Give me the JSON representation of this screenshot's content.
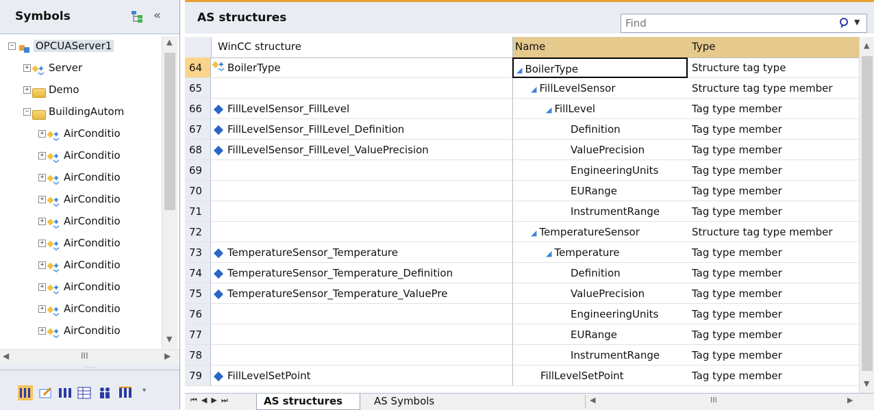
{
  "left_panel": {
    "title": "Symbols",
    "tree": [
      {
        "label": "OPCUAServer1",
        "level": 0,
        "expander": "−",
        "icon": "server-root-icon"
      },
      {
        "label": "Server",
        "level": 1,
        "expander": "+",
        "icon": "structure-icon"
      },
      {
        "label": "Demo",
        "level": 1,
        "expander": "+",
        "icon": "folder-icon"
      },
      {
        "label": "BuildingAutom",
        "level": 1,
        "expander": "−",
        "icon": "folder-icon"
      },
      {
        "label": "AirConditio",
        "level": 2,
        "expander": "+",
        "icon": "structure-icon"
      },
      {
        "label": "AirConditio",
        "level": 2,
        "expander": "+",
        "icon": "structure-icon"
      },
      {
        "label": "AirConditio",
        "level": 2,
        "expander": "+",
        "icon": "structure-icon"
      },
      {
        "label": "AirConditio",
        "level": 2,
        "expander": "+",
        "icon": "structure-icon"
      },
      {
        "label": "AirConditio",
        "level": 2,
        "expander": "+",
        "icon": "structure-icon"
      },
      {
        "label": "AirConditio",
        "level": 2,
        "expander": "+",
        "icon": "structure-icon"
      },
      {
        "label": "AirConditio",
        "level": 2,
        "expander": "+",
        "icon": "structure-icon"
      },
      {
        "label": "AirConditio",
        "level": 2,
        "expander": "+",
        "icon": "structure-icon"
      },
      {
        "label": "AirConditio",
        "level": 2,
        "expander": "+",
        "icon": "structure-icon"
      },
      {
        "label": "AirConditio",
        "level": 2,
        "expander": "+",
        "icon": "structure-icon"
      }
    ],
    "scroll_grip": "III",
    "splitter_grip": "......"
  },
  "right_panel": {
    "title": "AS structures",
    "find_placeholder": "Find",
    "columns": {
      "wincc": "WinCC structure",
      "name": "Name",
      "type": "Type"
    },
    "rows": [
      {
        "num": "64",
        "wincc": "BoilerType",
        "wincc_icon": "structure",
        "name": "BoilerType",
        "name_indent": 0,
        "name_tri": true,
        "type": "Structure tag type",
        "selected": true
      },
      {
        "num": "65",
        "wincc": "",
        "wincc_icon": "",
        "name": "FillLevelSensor",
        "name_indent": 1,
        "name_tri": true,
        "type": "Structure tag type member"
      },
      {
        "num": "66",
        "wincc": "FillLevelSensor_FillLevel",
        "wincc_icon": "tag",
        "name": "FillLevel",
        "name_indent": 2,
        "name_tri": true,
        "type": "Tag type member"
      },
      {
        "num": "67",
        "wincc": "FillLevelSensor_FillLevel_Definition",
        "wincc_icon": "tag",
        "name": "Definition",
        "name_indent": 3,
        "name_tri": false,
        "type": "Tag type member"
      },
      {
        "num": "68",
        "wincc": "FillLevelSensor_FillLevel_ValuePrecision",
        "wincc_icon": "tag",
        "name": "ValuePrecision",
        "name_indent": 3,
        "name_tri": false,
        "type": "Tag type member"
      },
      {
        "num": "69",
        "wincc": "",
        "wincc_icon": "",
        "name": "EngineeringUnits",
        "name_indent": 3,
        "name_tri": false,
        "type": "Tag type member"
      },
      {
        "num": "70",
        "wincc": "",
        "wincc_icon": "",
        "name": "EURange",
        "name_indent": 3,
        "name_tri": false,
        "type": "Tag type member"
      },
      {
        "num": "71",
        "wincc": "",
        "wincc_icon": "",
        "name": "InstrumentRange",
        "name_indent": 3,
        "name_tri": false,
        "type": "Tag type member"
      },
      {
        "num": "72",
        "wincc": "",
        "wincc_icon": "",
        "name": "TemperatureSensor",
        "name_indent": 1,
        "name_tri": true,
        "type": "Structure tag type member"
      },
      {
        "num": "73",
        "wincc": "TemperatureSensor_Temperature",
        "wincc_icon": "tag",
        "name": "Temperature",
        "name_indent": 2,
        "name_tri": true,
        "type": "Tag type member"
      },
      {
        "num": "74",
        "wincc": "TemperatureSensor_Temperature_Definition",
        "wincc_icon": "tag",
        "name": "Definition",
        "name_indent": 3,
        "name_tri": false,
        "type": "Tag type member"
      },
      {
        "num": "75",
        "wincc": "TemperatureSensor_Temperature_ValuePre",
        "wincc_icon": "tag",
        "name": "ValuePrecision",
        "name_indent": 3,
        "name_tri": false,
        "type": "Tag type member"
      },
      {
        "num": "76",
        "wincc": "",
        "wincc_icon": "",
        "name": "EngineeringUnits",
        "name_indent": 3,
        "name_tri": false,
        "type": "Tag type member"
      },
      {
        "num": "77",
        "wincc": "",
        "wincc_icon": "",
        "name": "EURange",
        "name_indent": 3,
        "name_tri": false,
        "type": "Tag type member"
      },
      {
        "num": "78",
        "wincc": "",
        "wincc_icon": "",
        "name": "InstrumentRange",
        "name_indent": 3,
        "name_tri": false,
        "type": "Tag type member"
      },
      {
        "num": "79",
        "wincc": "FillLevelSetPoint",
        "wincc_icon": "tag",
        "name": "FillLevelSetPoint",
        "name_indent": 1,
        "name_tri": false,
        "type": "Tag type member"
      }
    ],
    "sheet_tabs": [
      "AS structures",
      "AS Symbols"
    ],
    "active_tab": "AS structures",
    "scroll_grip": "III"
  },
  "colors": {
    "accent_orange": "#e8a030",
    "selected_row": "#fbd38a",
    "header_bg": "#e9edf3",
    "tree_triangle": "#3a84d8",
    "tag_icon": "#2a66c8"
  }
}
